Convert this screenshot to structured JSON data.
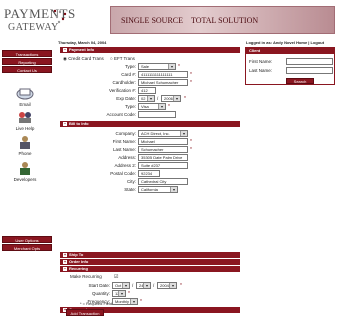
{
  "brand": {
    "logo_line1": "PAYMENTS",
    "logo_line2": "GATEWAY",
    "banner_left": "SINGLE SOURCE",
    "banner_right": "TOTAL SOLUTION",
    "accent": "#8a1620"
  },
  "header": {
    "date": "Thursday, March 04, 2004",
    "logged_in": "Logged in as: Andy Novel  Home | Logout"
  },
  "sidebar": {
    "top_buttons": [
      "Transactions",
      "Reporting",
      "Contact Us"
    ],
    "icons": [
      {
        "label": "Email",
        "icon": "email-icon"
      },
      {
        "label": "Live Help",
        "icon": "live-help-icon"
      },
      {
        "label": "Phone",
        "icon": "phone-icon"
      },
      {
        "label": "Developers",
        "icon": "developers-icon"
      }
    ],
    "bottom_buttons": [
      "User Options",
      "Merchant Opts"
    ]
  },
  "payment": {
    "section": "Payment Info",
    "radio_cc": "Credit Card Trans",
    "radio_eft": "EFT Trans",
    "type_label": "Type:",
    "type_value": "Sale",
    "card_label": "Card #:",
    "card_value": "4111111111111111",
    "holder_label": "Cardholder:",
    "holder_value": "Michael Schumacher",
    "verif_label": "Verification #:",
    "verif_value": "412",
    "exp_label": "Exp Date:",
    "exp_month": "02",
    "exp_year": "2006",
    "ctype_label": "Type:",
    "ctype_value": "Visa",
    "acct_label": "Account Code:",
    "acct_value": ""
  },
  "billto": {
    "section": "Bill to Info",
    "company_label": "Company:",
    "company_value": "ACH Direct, Inc.",
    "first_label": "First Name:",
    "first_value": "Michael",
    "last_label": "Last Name:",
    "last_value": "Schumacher",
    "addr_label": "Address:",
    "addr_value": "35305 Date Palm Drive",
    "addr2_label": "Address 2:",
    "addr2_value": "Suite #237",
    "postal_label": "Postal Code:",
    "postal_value": "92234",
    "city_label": "City:",
    "city_value": "Cathedral City",
    "state_label": "State:",
    "state_value": "California"
  },
  "collapsed": [
    "Ship To",
    "Order Info",
    "Recurring"
  ],
  "recurring": {
    "make_label": "Make Recurring",
    "start_label": "Start Date:",
    "start_month": "Oct",
    "start_day": "24",
    "start_year": "2004",
    "qty_label": "Quantity:",
    "qty_value": "12",
    "freq_label": "Frequency:",
    "freq_value": "Monthly"
  },
  "comments": {
    "section": "Comments"
  },
  "footer": {
    "required_note": "* = Required Field",
    "submit": "Add Transaction"
  },
  "client": {
    "title": "Client",
    "first_label": "First Name:",
    "last_label": "Last Name:",
    "search": "Search"
  }
}
